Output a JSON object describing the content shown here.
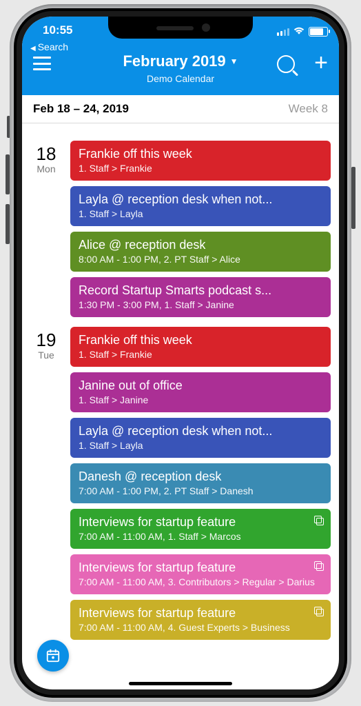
{
  "status": {
    "time": "10:55",
    "back": "Search"
  },
  "header": {
    "title": "February 2019",
    "subtitle": "Demo Calendar"
  },
  "week": {
    "range": "Feb 18 – 24, 2019",
    "label": "Week 8"
  },
  "colors": {
    "red": "#d8232a",
    "blue": "#3954b8",
    "green": "#5f8f23",
    "purple": "#ab2f95",
    "teal": "#3a8bb3",
    "brightgreen": "#31a52e",
    "pink": "#e667b6",
    "gold": "#c9b028"
  },
  "days": [
    {
      "date": "18",
      "dow": "Mon",
      "events": [
        {
          "title": "Frankie off this week",
          "sub": "1. Staff > Frankie",
          "color": "red"
        },
        {
          "title": "Layla @ reception desk when not...",
          "sub": "1. Staff > Layla",
          "color": "blue"
        },
        {
          "title": "Alice @ reception desk",
          "sub": "8:00 AM - 1:00 PM, 2. PT Staff > Alice",
          "color": "green"
        },
        {
          "title": "Record Startup Smarts podcast s...",
          "sub": "1:30 PM - 3:00 PM, 1. Staff > Janine",
          "color": "purple"
        }
      ]
    },
    {
      "date": "19",
      "dow": "Tue",
      "events": [
        {
          "title": "Frankie off this week",
          "sub": "1. Staff > Frankie",
          "color": "red"
        },
        {
          "title": "Janine out of office",
          "sub": "1. Staff > Janine",
          "color": "purple"
        },
        {
          "title": "Layla @ reception desk when not...",
          "sub": "1. Staff > Layla",
          "color": "blue"
        },
        {
          "title": "Danesh @ reception desk",
          "sub": "7:00 AM - 1:00 PM, 2. PT Staff > Danesh",
          "color": "teal"
        },
        {
          "title": "Interviews for startup feature",
          "sub": "7:00 AM - 11:00 AM, 1. Staff > Marcos",
          "color": "brightgreen",
          "copy": true
        },
        {
          "title": "Interviews for startup feature",
          "sub": "7:00 AM - 11:00 AM, 3. Contributors > Regular > Darius",
          "color": "pink",
          "copy": true
        },
        {
          "title": "Interviews for startup feature",
          "sub": "7:00 AM - 11:00 AM, 4. Guest Experts > Business",
          "color": "gold",
          "copy": true
        }
      ]
    }
  ]
}
